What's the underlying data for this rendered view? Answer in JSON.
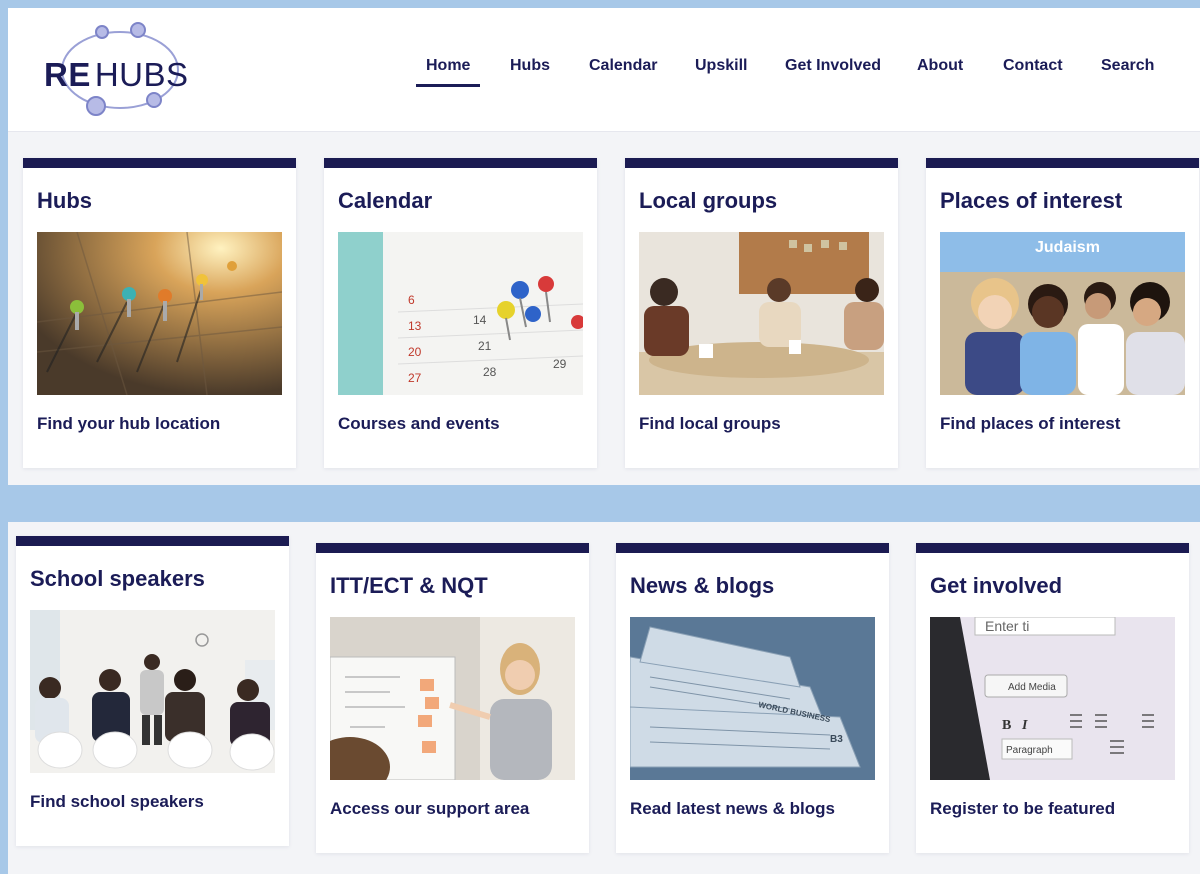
{
  "brand": {
    "logo_bold": "RE",
    "logo_light": "HUBS"
  },
  "nav": {
    "items": [
      {
        "label": "Home",
        "active": true
      },
      {
        "label": "Hubs"
      },
      {
        "label": "Calendar"
      },
      {
        "label": "Upskill"
      },
      {
        "label": "Get Involved"
      },
      {
        "label": "About"
      },
      {
        "label": "Contact"
      },
      {
        "label": "Search"
      }
    ]
  },
  "cards_top": [
    {
      "title": "Hubs",
      "link": "Find your hub location",
      "image": "map-pins-photo"
    },
    {
      "title": "Calendar",
      "link": "Courses and events",
      "image": "calendar-pins-photo"
    },
    {
      "title": "Local groups",
      "link": "Find local groups",
      "image": "meeting-photo"
    },
    {
      "title": "Places of interest",
      "link": "Find places of interest",
      "image": "children-photo"
    }
  ],
  "cards_bottom": [
    {
      "title": "School speakers",
      "link": "Find school speakers",
      "image": "speaker-photo"
    },
    {
      "title": "ITT/ECT & NQT",
      "link": "Access our support area",
      "image": "teacher-photo"
    },
    {
      "title": "News & blogs",
      "link": "Read latest news & blogs",
      "image": "newspapers-photo"
    },
    {
      "title": "Get involved",
      "link": "Register to be featured",
      "image": "editor-photo",
      "image_text": {
        "enter": "Enter ti",
        "add_media": "Add Media",
        "paragraph": "Paragraph"
      }
    }
  ],
  "photo_text": {
    "judaism": "Judaism",
    "calendar_numbers": [
      "6",
      "13",
      "20",
      "27",
      "14",
      "21",
      "28",
      "29"
    ],
    "news_business": "WORLD BUSINESS",
    "news_page": "B3"
  },
  "colors": {
    "accent": "#1b1b52",
    "page_bg": "#a7c8e8",
    "panel_bg": "#f3f4f7"
  }
}
